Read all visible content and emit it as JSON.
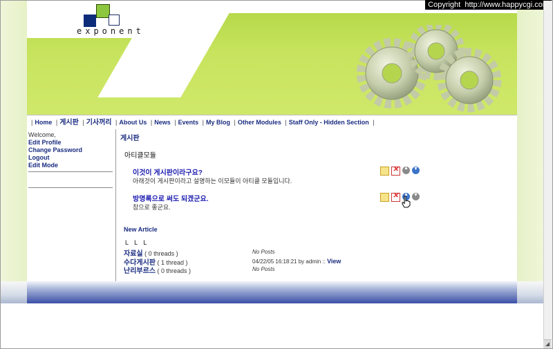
{
  "copyright": "Copyright  http://www.happycgi.com",
  "logo": {
    "text": "exponent"
  },
  "nav": {
    "items": [
      {
        "label": "Home"
      },
      {
        "label": "게시판"
      },
      {
        "label": "기사꺼리"
      },
      {
        "label": "About Us"
      },
      {
        "label": "News"
      },
      {
        "label": "Events"
      },
      {
        "label": "My Blog"
      },
      {
        "label": "Other Modules"
      },
      {
        "label": "Staff Only - Hidden Section"
      }
    ]
  },
  "sidebar": {
    "welcome": "Welcome,",
    "links": [
      {
        "label": "Edit Profile"
      },
      {
        "label": "Change Password"
      },
      {
        "label": "Logout"
      },
      {
        "label": "Edit Mode"
      }
    ]
  },
  "main": {
    "breadcrumb": "게시판",
    "section_title": "아티클모듈",
    "articles": [
      {
        "title": "이것이 게시판이라구요?",
        "desc": "아래것이 게시판이라고 설명하는 이모듈이 아티클 모듈입니다."
      },
      {
        "title": "방명록으로 써도 되겠군요.",
        "desc": "참으로 좋군요."
      }
    ],
    "new_article": "New Article",
    "tree_marks": "L L L",
    "categories": [
      {
        "name": "자료실",
        "threads": "( 0 threads )",
        "post": "No Posts"
      },
      {
        "name": "수다게시판",
        "threads": "( 1 thread )",
        "post": "04/22/05 16:18:21 by admin :: ",
        "post_link": "View"
      },
      {
        "name": "난리부르스",
        "threads": "( 0 threads )",
        "post": "No Posts"
      }
    ]
  },
  "icons": {
    "edit": "edit-icon",
    "delete": "delete-icon",
    "move_up": "arrow-up-icon",
    "move_down": "arrow-down-icon"
  }
}
